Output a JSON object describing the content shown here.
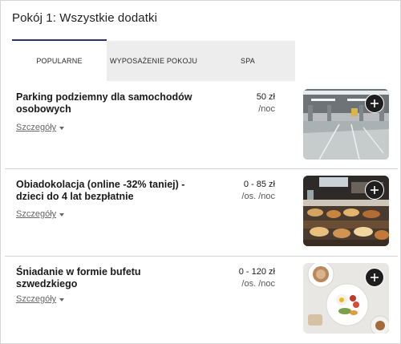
{
  "header": {
    "title": "Pokój 1: Wszystkie dodatki"
  },
  "tabs": [
    {
      "label": "POPULARNE",
      "active": true
    },
    {
      "label": "WYPOSAŻENIE POKOJU",
      "active": false
    },
    {
      "label": "SPA",
      "active": false
    }
  ],
  "items": [
    {
      "name": "Parking podziemny dla samochodów osobowych",
      "price": "50 zł",
      "unit": "/noc",
      "details_label": "Szczegóły",
      "image_icon": "parking-garage-photo",
      "add_icon": "plus-icon"
    },
    {
      "name": "Obiadokolacja (online -32% taniej) - dzieci do 4 lat bezpłatnie",
      "price": "0 - 85 zł",
      "unit": "/os. /noc",
      "details_label": "Szczegóły",
      "image_icon": "buffet-dinner-photo",
      "add_icon": "plus-icon"
    },
    {
      "name": "Śniadanie w formie bufetu szwedzkiego",
      "price": "0 - 120 zł",
      "unit": "/os. /noc",
      "details_label": "Szczegóły",
      "image_icon": "breakfast-photo",
      "add_icon": "plus-icon"
    }
  ],
  "colors": {
    "accent": "#2d2f6e",
    "tab_inactive_bg": "#ededed",
    "add_button": "#1e1e1e"
  }
}
